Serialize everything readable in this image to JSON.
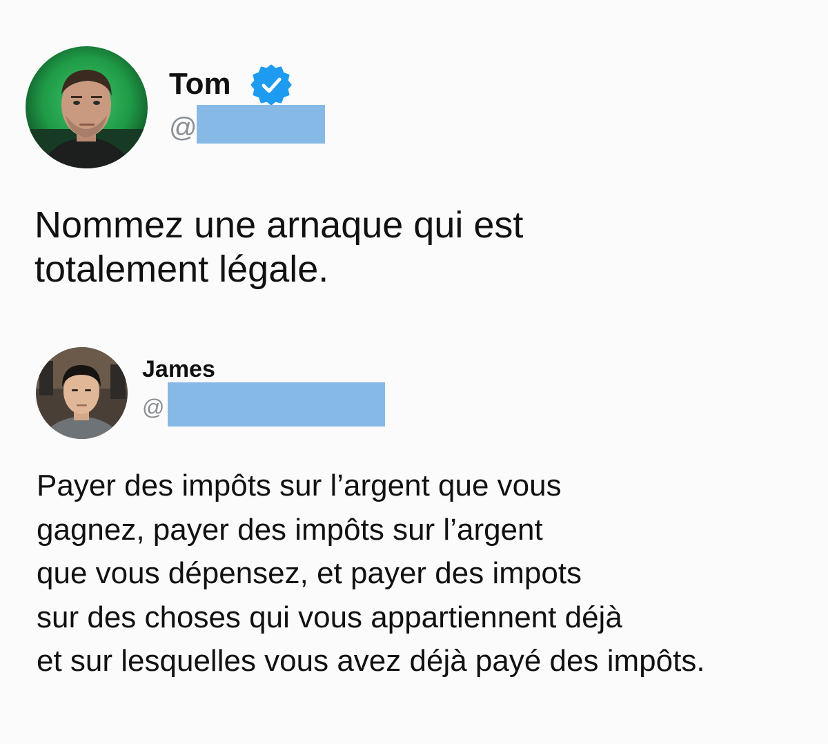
{
  "tweet": {
    "author": {
      "name": "Tom",
      "verified": true,
      "handle_prefix": "@",
      "avatar_icon": "avatar-photo-man-green-background"
    },
    "text": "Nommez une arnaque qui est\ntotalement légale."
  },
  "reply": {
    "author": {
      "name": "James",
      "handle_prefix": "@",
      "avatar_icon": "avatar-photo-young-man"
    },
    "text": "Payer des impôts sur l’argent que vous\ngagnez, payer des impôts sur l’argent\nque vous dépensez, et payer des impots\nsur des choses qui vous appartiennent déjà\net sur lesquelles vous avez déjà payé des impôts."
  },
  "colors": {
    "background": "#fbfbfb",
    "verified_blue": "#1d9bf0",
    "redaction_blue": "#87b9e6",
    "handle_gray": "#8a8f94"
  }
}
